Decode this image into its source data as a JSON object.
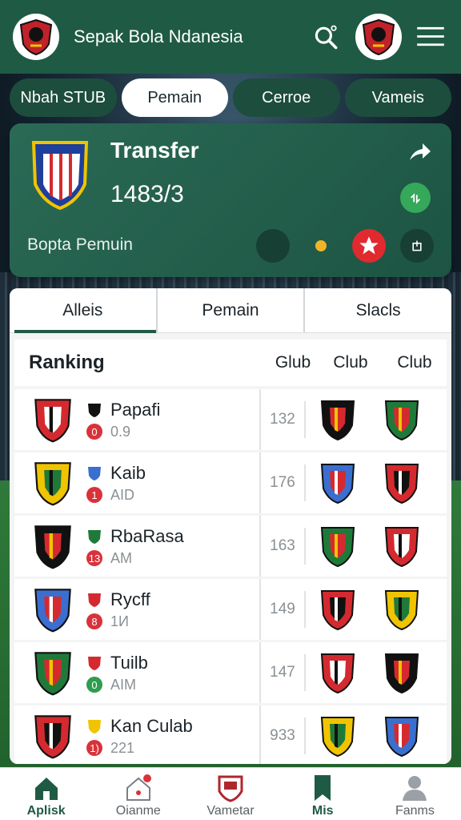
{
  "header": {
    "title": "Sepak Bola Ndanesia",
    "icons": [
      "club-crest",
      "search-icon",
      "club-crest",
      "menu-icon"
    ]
  },
  "tabs": [
    {
      "label": "Nbah STUB",
      "active": false
    },
    {
      "label": "Pemain",
      "active": true
    },
    {
      "label": "Cerroe",
      "active": false
    },
    {
      "label": "Vameis",
      "active": false
    }
  ],
  "transfer": {
    "title": "Transfer",
    "value": "1483/3",
    "subtitle": "Bopta Pemuin"
  },
  "subtabs": [
    {
      "label": "Alleis",
      "active": true
    },
    {
      "label": "Pemain",
      "active": false
    },
    {
      "label": "Slacls",
      "active": false
    }
  ],
  "ranking": {
    "title": "Ranking",
    "columns": [
      "Glub",
      "Club",
      "Club"
    ],
    "rows": [
      {
        "name": "Papafi",
        "badge": "0",
        "meta": "0.9",
        "value": "132"
      },
      {
        "name": "Kaib",
        "badge": "1",
        "meta": "AID",
        "value": "176"
      },
      {
        "name": "RbaRasa",
        "badge": "13",
        "meta": "AM",
        "value": "163"
      },
      {
        "name": "Rycff",
        "badge": "8",
        "meta": "1И",
        "value": "149"
      },
      {
        "name": "Tuilb",
        "badge": "0",
        "meta": "AIM",
        "value": "147"
      },
      {
        "name": "Kan Culab",
        "badge": "1)",
        "meta": "221",
        "value": "933"
      }
    ]
  },
  "nav": [
    {
      "label": "Aplisk",
      "icon": "home-icon",
      "active": true
    },
    {
      "label": "Oianme",
      "icon": "notification-house-icon",
      "active": false
    },
    {
      "label": "Vametar",
      "icon": "shield-icon",
      "active": false
    },
    {
      "label": "Mis",
      "icon": "bookmark-icon",
      "active": true
    },
    {
      "label": "Fanms",
      "icon": "profile-icon",
      "active": false
    }
  ],
  "colors": {
    "primary": "#1f5a45",
    "accent_red": "#e02a2f",
    "accent_green": "#35a85a"
  }
}
